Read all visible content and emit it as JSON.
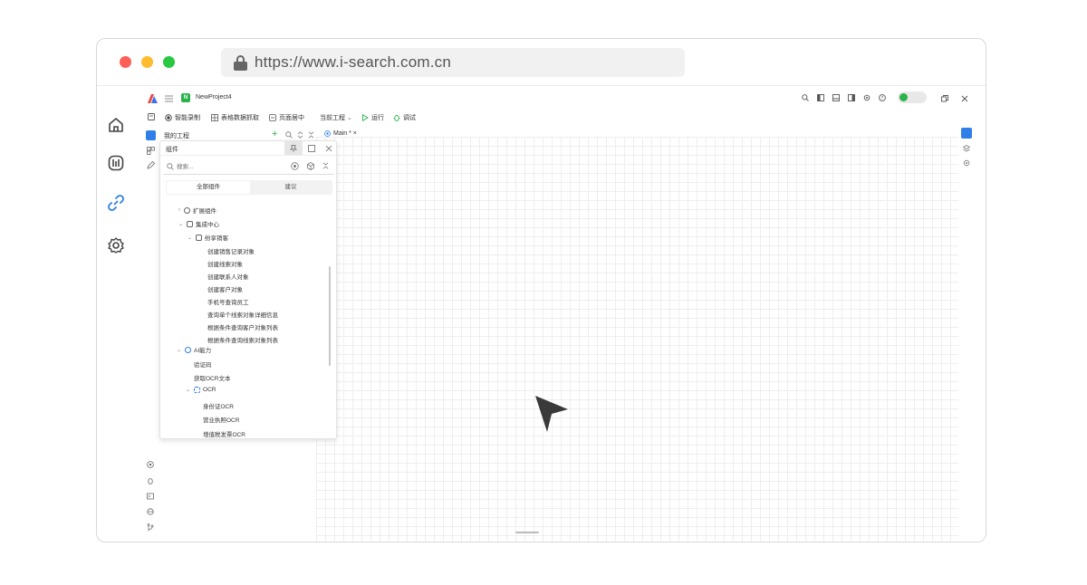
{
  "browser": {
    "url": "https://www.i-search.com.cn",
    "dot_colors": [
      "#fe5f57",
      "#febc2e",
      "#28c840"
    ]
  },
  "titlebar": {
    "project_badge": "N",
    "project_name": "NewProject4"
  },
  "toolbar": {
    "smart_record": "智能录制",
    "table_capture": "表格数据抓取",
    "page_center": "页面居中",
    "current_project": "当前工程",
    "run": "运行",
    "debug": "调试"
  },
  "project_panel": {
    "title": "我的工程"
  },
  "editor_tabs": [
    {
      "label": "Main * ×"
    }
  ],
  "component_panel": {
    "title": "组件",
    "search_placeholder": "搜索...",
    "tabs": [
      "全部组件",
      "建议"
    ],
    "tree": {
      "extension": "扩展组件",
      "integration": "集成中心",
      "fenxiang": "纷享销客",
      "fenxiang_items": [
        "创建销售记录对象",
        "创建线索对象",
        "创建联系人对象",
        "创建客户对象",
        "手机号查询员工",
        "查询单个线索对象详细信息",
        "根据条件查询客户对象列表",
        "根据条件查询线索对象列表"
      ],
      "ai": "AI能力",
      "ai_items": [
        "验证码",
        "获取OCR文本"
      ],
      "ocr": "OCR",
      "ocr_items": [
        "身份证OCR",
        "营业执照OCR",
        "增值税发票OCR"
      ]
    }
  },
  "colors": {
    "accent": "#2f7fe8",
    "green": "#2bb34b",
    "canvas_grid": "#eeeeee"
  },
  "icons": {
    "left_sidebar": [
      "home-icon",
      "dashboard-icon",
      "link-icon",
      "settings-icon"
    ],
    "cursor": "arrow-pointer-icon"
  }
}
